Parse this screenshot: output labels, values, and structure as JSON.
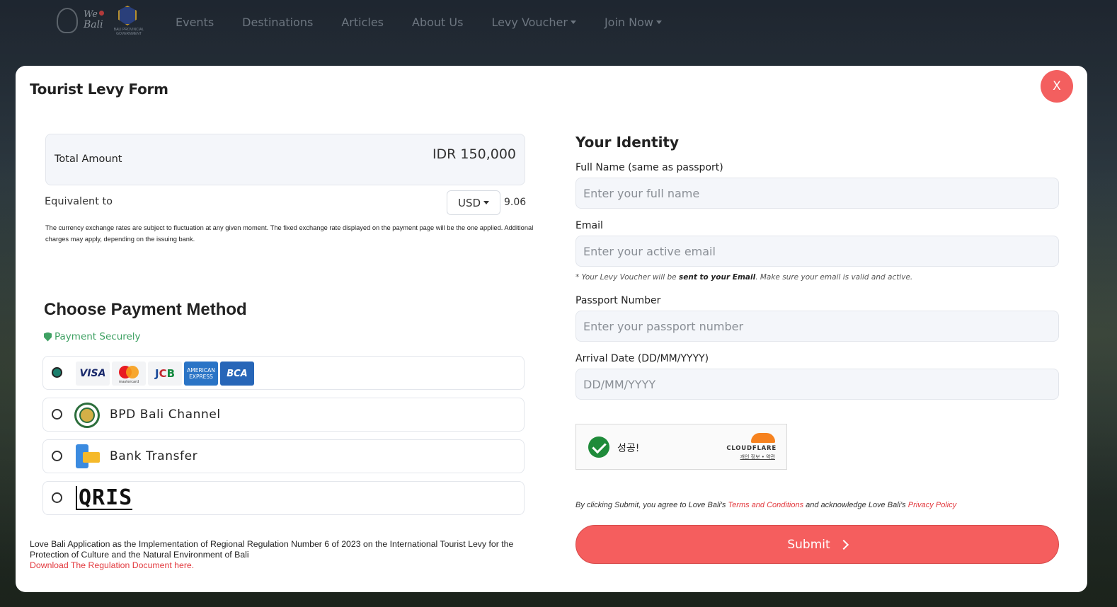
{
  "navbar": {
    "logo_text_1": "We",
    "logo_text_2": "Bali",
    "gov_text": "BALI PROVINCIAL GOVERNMENT",
    "items": [
      {
        "label": "Events"
      },
      {
        "label": "Destinations"
      },
      {
        "label": "Articles"
      },
      {
        "label": "About Us"
      },
      {
        "label": "Levy Voucher"
      },
      {
        "label": "Join Now"
      }
    ]
  },
  "modal": {
    "title": "Tourist Levy Form",
    "close_label": "X"
  },
  "amount": {
    "label": "Total Amount",
    "value": "IDR 150,000",
    "equivalent_label": "Equivalent to",
    "currency": "USD",
    "equivalent_value": "9.06",
    "fx_note": "The currency exchange rates are subject to fluctuation at any given moment. The fixed exchange rate displayed on the payment page will be the one applied. Additional charges may apply, depending on the issuing bank."
  },
  "payment": {
    "title": "Choose Payment Method",
    "secure_label": "Payment Securely",
    "cards": {
      "visa": "VISA",
      "mastercard": "mastercard",
      "jcb": [
        "J",
        "C",
        "B"
      ],
      "amex": "AMERICAN EXPRESS",
      "bca": "BCA"
    },
    "options": [
      {
        "label": "",
        "selected": true
      },
      {
        "label": "BPD Bali Channel",
        "selected": false
      },
      {
        "label": "Bank Transfer",
        "selected": false
      },
      {
        "label": "QRIS",
        "selected": false
      }
    ]
  },
  "footer": {
    "note": "Love Bali Application as the Implementation of Regional Regulation Number 6 of 2023 on the International Tourist Levy for the Protection of Culture and the Natural Environment of Bali",
    "link": "Download The Regulation Document here."
  },
  "identity": {
    "title": "Your Identity",
    "full_name": {
      "label": "Full Name (same as passport)",
      "placeholder": "Enter your full name",
      "value": ""
    },
    "email": {
      "label": "Email",
      "placeholder": "Enter your active email",
      "value": ""
    },
    "email_hint_pre": "* Your Levy Voucher will be ",
    "email_hint_bold": "sent to your Email",
    "email_hint_post": ". Make sure your email is valid and active.",
    "passport": {
      "label": "Passport Number",
      "placeholder": "Enter your passport number",
      "value": ""
    },
    "arrival": {
      "label": "Arrival Date (DD/MM/YYYY)",
      "placeholder": "DD/MM/YYYY",
      "value": ""
    }
  },
  "captcha": {
    "status": "성공!",
    "brand": "CLOUDFLARE",
    "links": "개인 정보 • 약관"
  },
  "agreement": {
    "pre": "By clicking Submit, you agree to Love Bali's ",
    "terms": "Terms and Conditions",
    "mid": " and acknowledge Love Bali's ",
    "privacy": "Privacy Policy"
  },
  "submit_label": "Submit",
  "colors": {
    "accent": "#f55e5e",
    "secure_green": "#3fa163",
    "link_red": "#e2383d"
  }
}
